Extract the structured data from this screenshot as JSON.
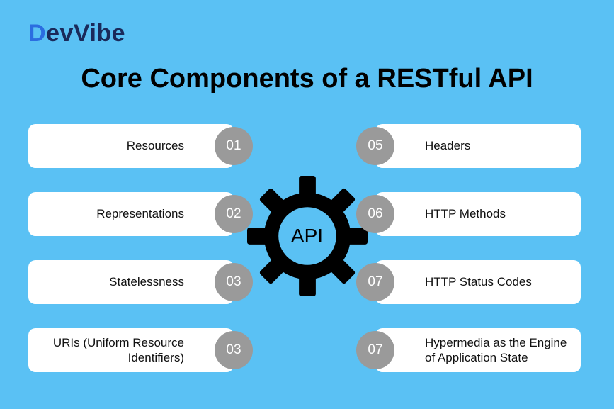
{
  "brand": {
    "part1": "D",
    "part2": "evVibe"
  },
  "title": "Core Components of a RESTful API",
  "center": {
    "label": "API"
  },
  "left_items": [
    {
      "num": "01",
      "label": "Resources"
    },
    {
      "num": "02",
      "label": "Representations"
    },
    {
      "num": "03",
      "label": "Statelessness"
    },
    {
      "num": "03",
      "label": "URIs (Uniform Resource Identifiers)"
    }
  ],
  "right_items": [
    {
      "num": "05",
      "label": "Headers"
    },
    {
      "num": "06",
      "label": "HTTP Methods"
    },
    {
      "num": "07",
      "label": "HTTP Status Codes"
    },
    {
      "num": "07",
      "label": "Hypermedia as the Engine of Application State"
    }
  ]
}
